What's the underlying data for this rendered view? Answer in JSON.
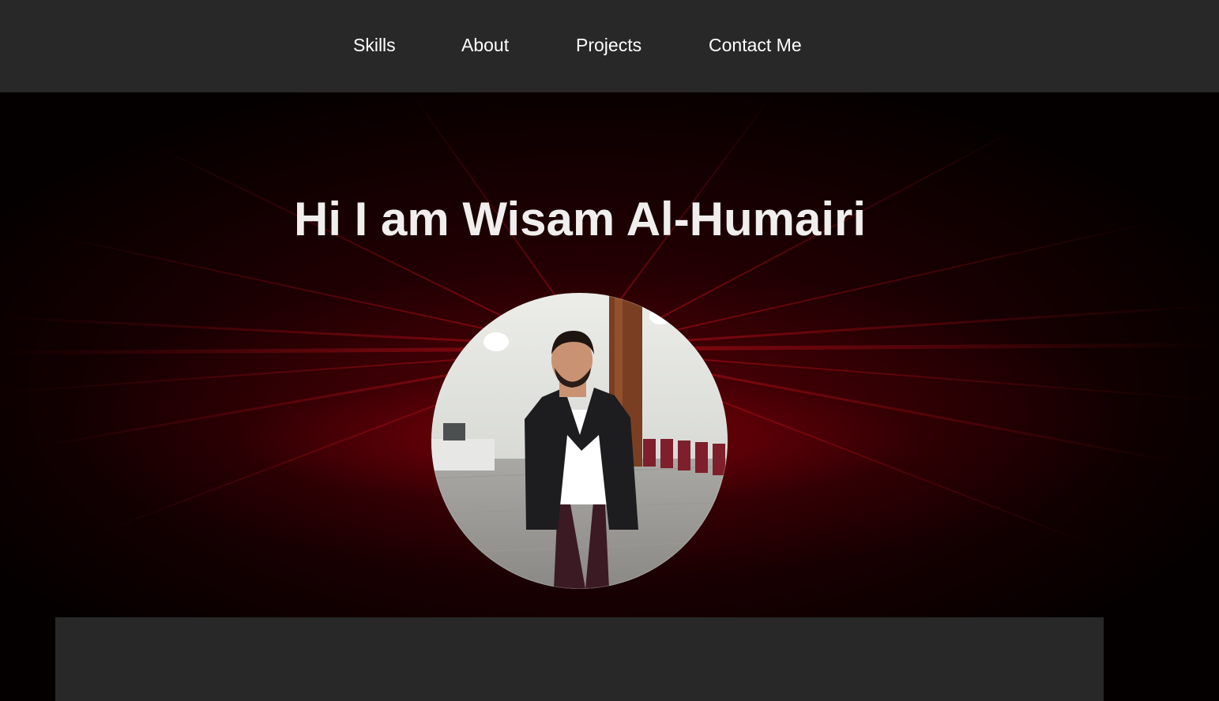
{
  "nav": {
    "skills": "Skills",
    "about": "About",
    "projects": "Projects",
    "contact": "Contact Me"
  },
  "hero": {
    "title": "Hi I am Wisam Al-Humairi"
  },
  "colors": {
    "navbar_bg": "#282828",
    "nav_text": "#ffffff",
    "hero_accent": "#8b0008",
    "title_text": "#f1eeee",
    "panel_bg": "#282828"
  }
}
